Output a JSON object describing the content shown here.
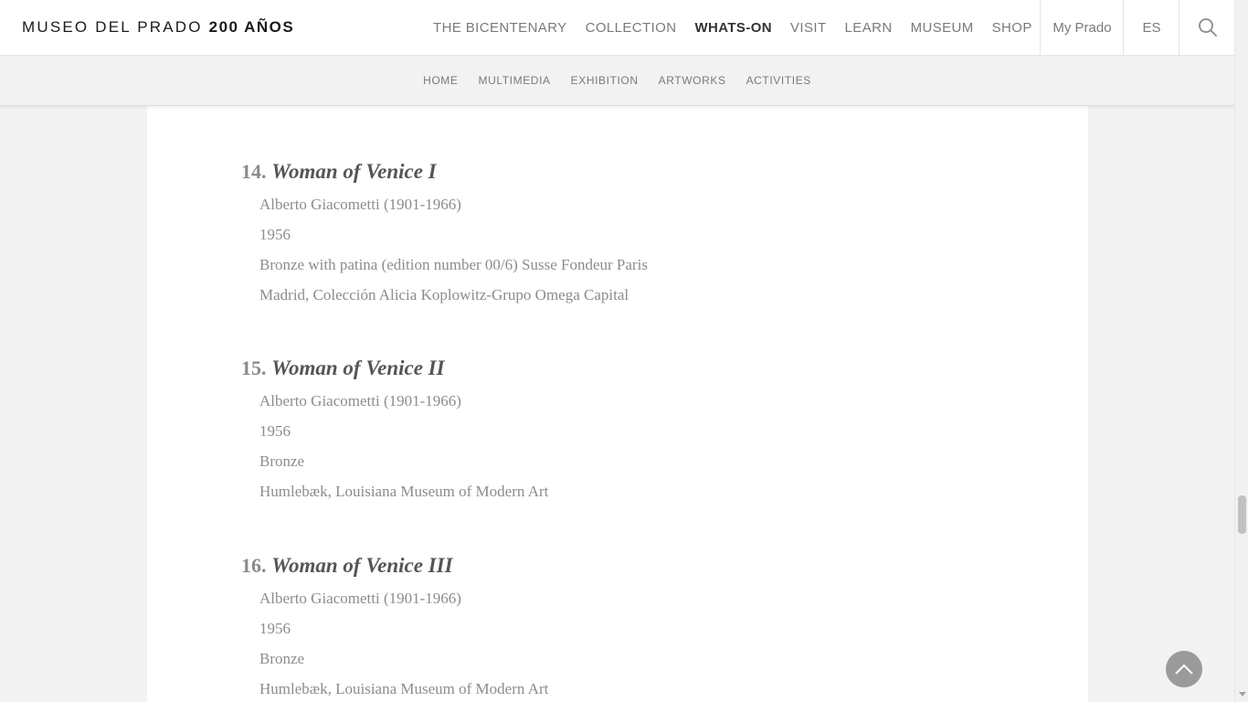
{
  "header": {
    "logo_text": "MUSEO DEL PRADO",
    "logo_bold": "200 AÑOS",
    "nav": [
      {
        "label": "THE BICENTENARY",
        "active": false
      },
      {
        "label": "COLLECTION",
        "active": false
      },
      {
        "label": "WHATS-ON",
        "active": true
      },
      {
        "label": "VISIT",
        "active": false
      },
      {
        "label": "LEARN",
        "active": false
      },
      {
        "label": "MUSEUM",
        "active": false
      },
      {
        "label": "SHOP",
        "active": false
      }
    ],
    "my_prado": "My Prado",
    "language": "ES",
    "search_icon": "search-icon"
  },
  "sub_nav": [
    "HOME",
    "MULTIMEDIA",
    "EXHIBITION",
    "ARTWORKS",
    "ACTIVITIES"
  ],
  "artworks": [
    {
      "number": "14.",
      "title": "Woman of Venice I",
      "lines": [
        "Alberto Giacometti (1901-1966)",
        "1956",
        "Bronze with patina (edition number 00/6) Susse Fondeur Paris",
        "Madrid, Colección Alicia Koplowitz-Grupo Omega Capital"
      ]
    },
    {
      "number": "15.",
      "title": "Woman of Venice II",
      "lines": [
        "Alberto Giacometti (1901-1966)",
        "1956",
        "Bronze",
        "Humlebæk, Louisiana Museum of Modern Art"
      ]
    },
    {
      "number": "16.",
      "title": "Woman of Venice III",
      "lines": [
        "Alberto Giacometti (1901-1966)",
        "1956",
        "Bronze",
        "Humlebæk, Louisiana Museum of Modern Art"
      ]
    }
  ],
  "colors": {
    "header_bg": "#ffffff",
    "page_bg": "#f2f2f2",
    "nav_text": "#7a7a7a",
    "nav_active": "#333333",
    "title_italic": "#555555",
    "meta_text": "#8c8c8c",
    "back_to_top_bg": "#9a9a9a"
  },
  "back_to_top_icon": "chevron-up-icon"
}
